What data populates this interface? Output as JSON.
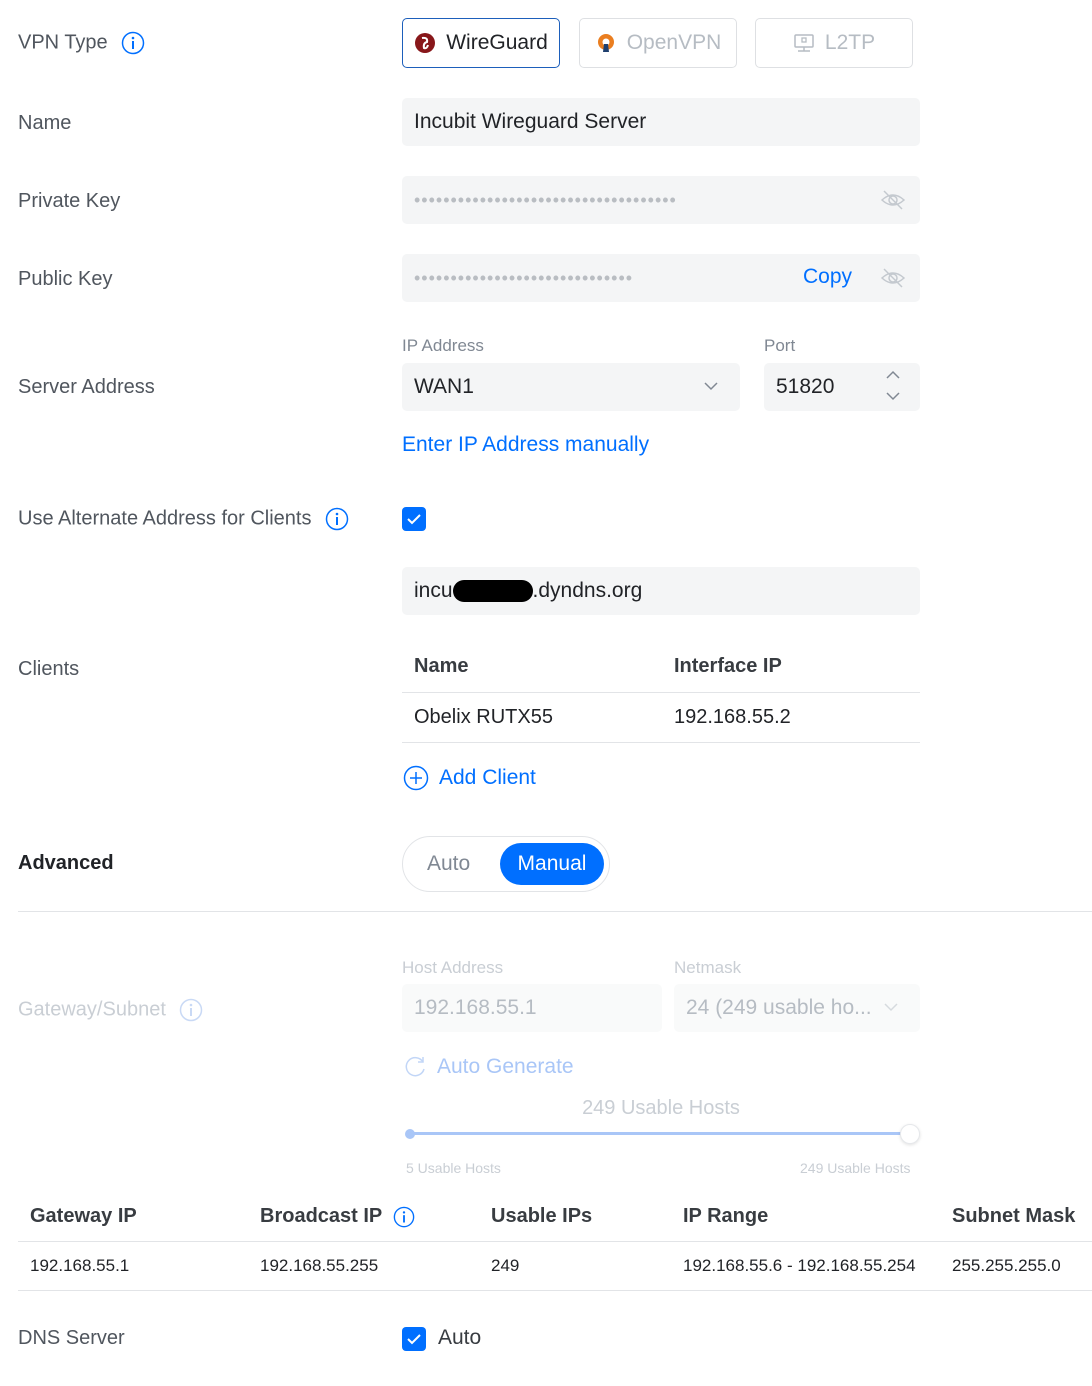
{
  "vpn_type": {
    "label": "VPN Type",
    "options": [
      "WireGuard",
      "OpenVPN",
      "L2TP"
    ],
    "selected": "WireGuard"
  },
  "name": {
    "label": "Name",
    "value": "Incubit Wireguard Server"
  },
  "private_key": {
    "label": "Private Key",
    "masked": "••••••••••••••••••••••••••••••••••••"
  },
  "public_key": {
    "label": "Public Key",
    "masked": "••••••••••••••••••••••••••••••",
    "copy_label": "Copy"
  },
  "server_address": {
    "label": "Server Address",
    "ip_label": "IP Address",
    "ip_value": "WAN1",
    "port_label": "Port",
    "port_value": "51820",
    "manual_link": "Enter IP Address manually"
  },
  "alternate_address": {
    "label": "Use Alternate Address for Clients",
    "checked": true,
    "value_prefix": "incu",
    "value_suffix": ".dyndns.org"
  },
  "clients": {
    "label": "Clients",
    "columns": [
      "Name",
      "Interface IP"
    ],
    "rows": [
      [
        "Obelix RUTX55",
        "192.168.55.2"
      ]
    ],
    "add_label": "Add Client"
  },
  "advanced": {
    "label": "Advanced",
    "options": [
      "Auto",
      "Manual"
    ],
    "selected": "Manual"
  },
  "gateway_subnet": {
    "label": "Gateway/Subnet",
    "host_label": "Host Address",
    "host_value": "192.168.55.1",
    "netmask_label": "Netmask",
    "netmask_value": "24 (249 usable ho...",
    "auto_generate": "Auto Generate",
    "slider_title": "249 Usable Hosts",
    "slider_min_label": "5 Usable Hosts",
    "slider_max_label": "249 Usable Hosts",
    "slider_fraction": 1.0
  },
  "subnet_table": {
    "columns": [
      "Gateway IP",
      "Broadcast IP",
      "Usable IPs",
      "IP Range",
      "Subnet Mask"
    ],
    "row": [
      "192.168.55.1",
      "192.168.55.255",
      "249",
      "192.168.55.6 - 192.168.55.254",
      "255.255.255.0"
    ]
  },
  "dns_server": {
    "label": "DNS Server",
    "checked": true,
    "auto_label": "Auto"
  },
  "colors": {
    "accent": "#006fff",
    "wireguard_brand": "#88171a",
    "openvpn_brand": "#ea7e20"
  }
}
